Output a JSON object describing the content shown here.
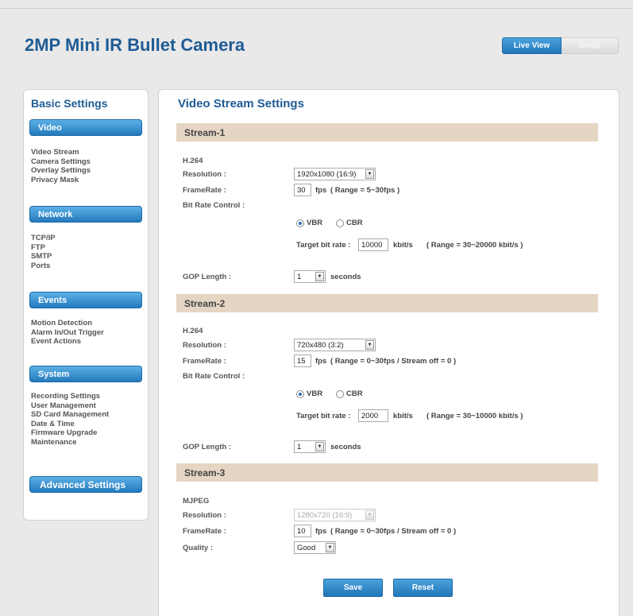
{
  "header": {
    "title": "2MP Mini IR Bullet Camera",
    "live_view_label": "Live View",
    "setup_label": "Setup"
  },
  "sidebar": {
    "title": "Basic Settings",
    "sections": [
      {
        "label": "Video",
        "items": [
          "Video Stream",
          "Camera Settings",
          "Overlay Settings",
          "Privacy Mask"
        ]
      },
      {
        "label": "Network",
        "items": [
          "TCP/IP",
          "FTP",
          "SMTP",
          "Ports"
        ]
      },
      {
        "label": "Events",
        "items": [
          "Motion Detection",
          "Alarm In/Out Trigger",
          "Event Actions"
        ]
      },
      {
        "label": "System",
        "items": [
          "Recording Settings",
          "User Management",
          "SD Card Management",
          "Date & Time",
          "Firmware Upgrade",
          "Maintenance"
        ]
      }
    ],
    "advanced_label": "Advanced Settings"
  },
  "main": {
    "title": "Video Stream Settings",
    "labels": {
      "resolution": "Resolution :",
      "framerate": "FrameRate :",
      "bitrate_control": "Bit Rate Control :",
      "gop_length": "GOP Length :",
      "quality": "Quality :",
      "fps": "fps",
      "vbr": "VBR",
      "cbr": "CBR",
      "target_bitrate": "Target bit rate :",
      "kbits": "kbit/s",
      "seconds": "seconds"
    },
    "streams": [
      {
        "name": "Stream-1",
        "codec": "H.264",
        "resolution": "1920x1080 (16:9)",
        "framerate": "30",
        "fps_range": "( Range = 5~30fps )",
        "bitrate_mode": "VBR",
        "target_bitrate": "10000",
        "bitrate_range": "( Range = 30~20000 kbit/s )",
        "gop": "1"
      },
      {
        "name": "Stream-2",
        "codec": "H.264",
        "resolution": "720x480 (3:2)",
        "framerate": "15",
        "fps_range": "( Range = 0~30fps / Stream off = 0 )",
        "bitrate_mode": "VBR",
        "target_bitrate": "2000",
        "bitrate_range": "( Range = 30~10000 kbit/s )",
        "gop": "1"
      },
      {
        "name": "Stream-3",
        "codec": "MJPEG",
        "resolution": "1280x720 (16:9)",
        "framerate": "10",
        "fps_range": "( Range = 0~30fps / Stream off = 0 )",
        "quality": "Good"
      }
    ],
    "save_label": "Save",
    "reset_label": "Reset"
  },
  "colors": {
    "title_blue": "#1f5c95",
    "button_blue": "#2176b8",
    "stream_bar": "#e5d5c3"
  }
}
